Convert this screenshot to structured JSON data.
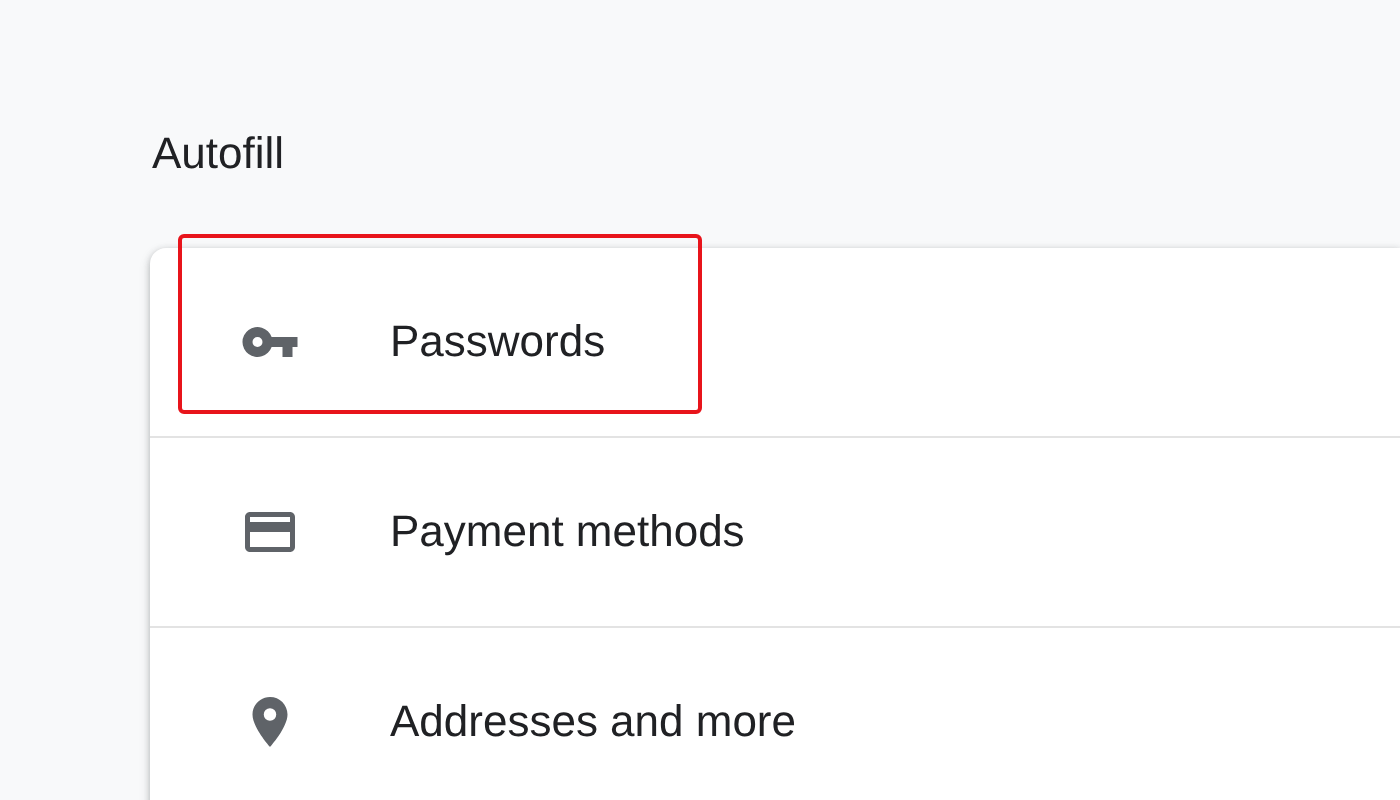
{
  "section": {
    "title": "Autofill"
  },
  "items": [
    {
      "kind": "key",
      "label": "Passwords",
      "highlighted": true
    },
    {
      "kind": "card",
      "label": "Payment methods",
      "highlighted": false
    },
    {
      "kind": "pin",
      "label": "Addresses and more",
      "highlighted": false
    }
  ]
}
